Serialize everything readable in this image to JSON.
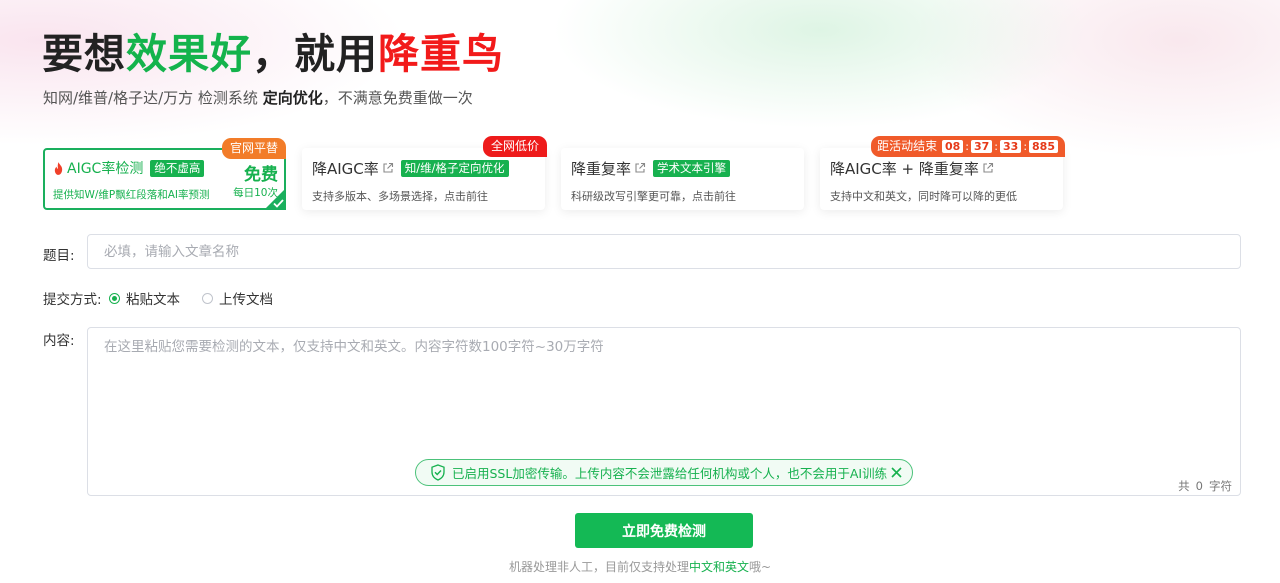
{
  "hero": {
    "title_part1": "要想",
    "title_part2": "效果好",
    "title_part3": "，就用",
    "title_part4": "降重鸟",
    "subtitle_part1": "知网/维普/格子达/万方 检测系统 ",
    "subtitle_bold": "定向优化",
    "subtitle_part2": "，不满意免费重做一次"
  },
  "cards": [
    {
      "title": "AIGC率检测",
      "tag": "绝不虚高",
      "desc": "提供知W/维P飘红段落和AI率预测",
      "free_big": "免费",
      "free_small": "每日10次",
      "ribbon": "官网平替",
      "active": true
    },
    {
      "title": "降AIGC率",
      "tag": "知/维/格子定向优化",
      "desc": "支持多版本、多场景选择，点击前往",
      "ribbon": "全网低价"
    },
    {
      "title": "降重复率",
      "tag": "学术文本引擎",
      "desc": "科研级改写引擎更可靠，点击前往"
    },
    {
      "title": "降AIGC率 + 降重复率",
      "desc": "支持中文和英文，同时降可以降的更低",
      "ribbon_label": "距活动结束",
      "timer": {
        "hours": "08",
        "minutes": "37",
        "seconds": "33",
        "millis": "885",
        "separator": ":"
      }
    }
  ],
  "form": {
    "title_label": "题目:",
    "title_placeholder": "必填，请输入文章名称",
    "method_label": "提交方式:",
    "method_options": [
      "粘贴文本",
      "上传文档"
    ],
    "method_selected": "粘贴文本",
    "content_label": "内容:",
    "content_placeholder": "在这里粘贴您需要检测的文本，仅支持中文和英文。内容字符数100字符~30万字符",
    "ssl_notice": "已启用SSL加密传输。上传内容不会泄露给任何机构或个人，也不会用于AI训练",
    "char_count_prefix": "共",
    "char_count": "0",
    "char_count_suffix": "字符",
    "submit_label": "立即免费检测"
  },
  "footnote": {
    "part1": "机器处理非人工，目前仅支持处理",
    "highlight": "中文和英文",
    "part2": "哦~"
  },
  "colors": {
    "brand_green": "#17b14f",
    "brand_red": "#f21a1a",
    "ribbon_orange": "#f27c29"
  },
  "icons": [
    "fire-icon",
    "external-link-icon",
    "check-icon",
    "shield-check-icon",
    "close-icon"
  ]
}
